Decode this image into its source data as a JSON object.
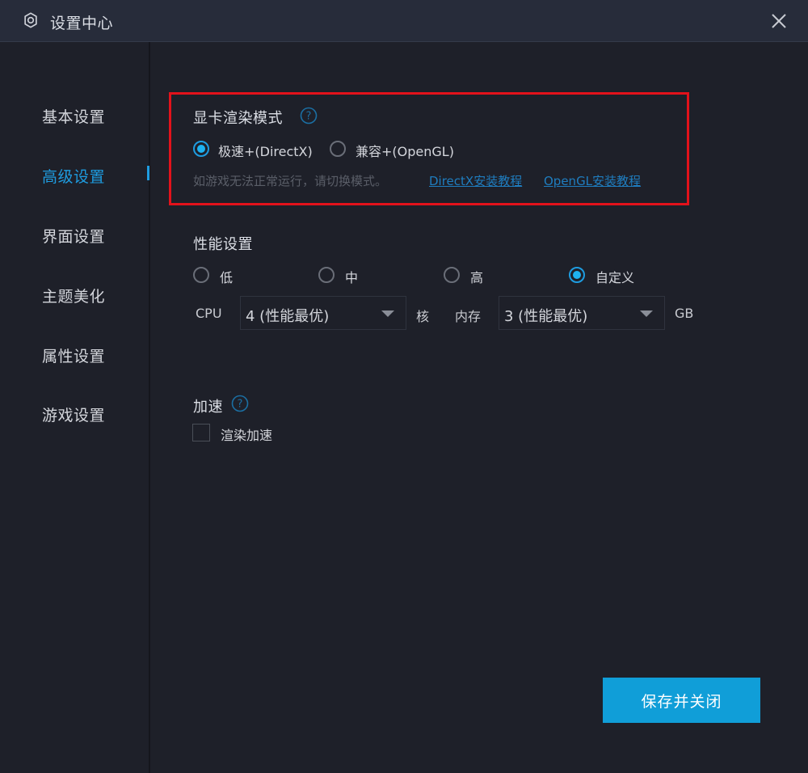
{
  "window": {
    "title": "设置中心",
    "title_icon": "gear-icon",
    "close_icon": "close-icon"
  },
  "sidebar": {
    "items": [
      {
        "label": "基本设置",
        "active": false
      },
      {
        "label": "高级设置",
        "active": true
      },
      {
        "label": "界面设置",
        "active": false
      },
      {
        "label": "主题美化",
        "active": false
      },
      {
        "label": "属性设置",
        "active": false
      },
      {
        "label": "游戏设置",
        "active": false
      }
    ]
  },
  "render_mode": {
    "title": "显卡渲染模式",
    "help_icon": "help-icon",
    "options": [
      {
        "label": "极速+(DirectX)",
        "checked": true
      },
      {
        "label": "兼容+(OpenGL)",
        "checked": false
      }
    ],
    "hint": "如游戏无法正常运行，请切换模式。",
    "links": [
      {
        "label": "DirectX安装教程"
      },
      {
        "label": "OpenGL安装教程"
      }
    ],
    "highlight_color": "#e3121b"
  },
  "performance": {
    "title": "性能设置",
    "options": [
      {
        "label": "低",
        "checked": false
      },
      {
        "label": "中",
        "checked": false
      },
      {
        "label": "高",
        "checked": false
      },
      {
        "label": "自定义",
        "checked": true
      }
    ],
    "cpu": {
      "label": "CPU",
      "value": "4 (性能最优)",
      "unit": "核"
    },
    "memory": {
      "label": "内存",
      "value": "3 (性能最优)",
      "unit": "GB"
    }
  },
  "acceleration": {
    "title": "加速",
    "help_icon": "help-icon",
    "checkbox_label": "渲染加速",
    "checked": false
  },
  "footer": {
    "save_label": "保存并关闭"
  },
  "colors": {
    "accent": "#1e9ce0",
    "button": "#109ed8",
    "background": "#1e2029",
    "titlebar": "#272c3a"
  }
}
